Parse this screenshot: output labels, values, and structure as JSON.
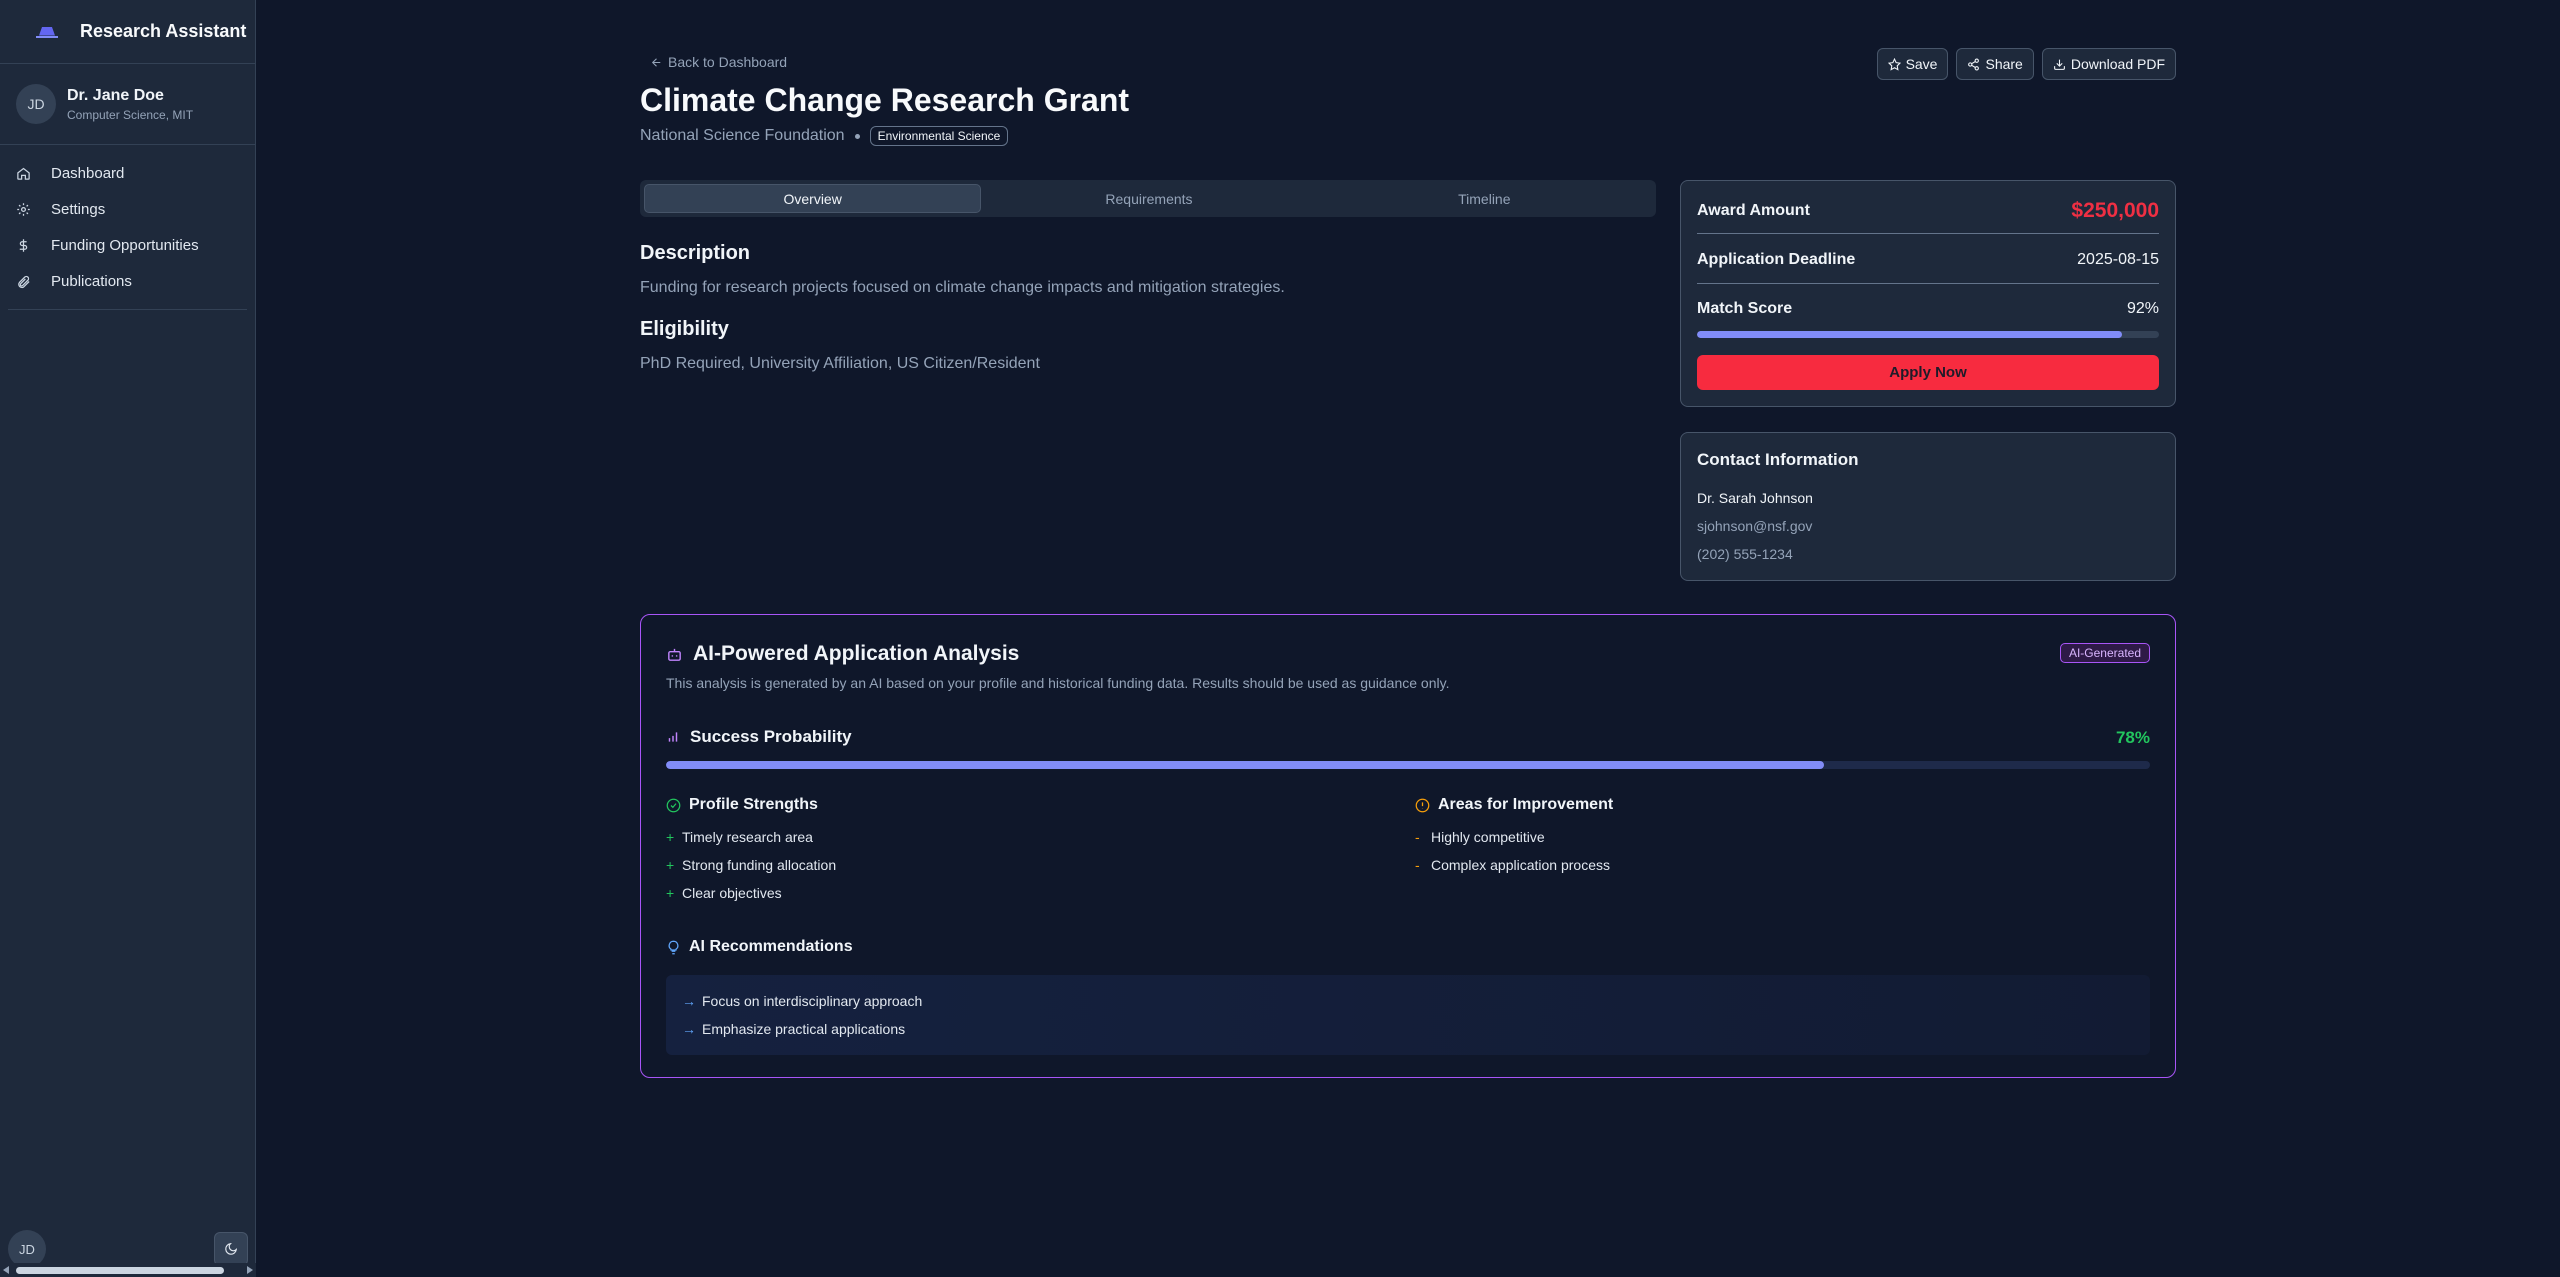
{
  "sidebar": {
    "app_name": "Research Assistant",
    "user": {
      "initials": "JD",
      "name": "Dr. Jane Doe",
      "affiliation": "Computer Science, MIT"
    },
    "nav": [
      {
        "label": "Dashboard",
        "icon": "home-icon"
      },
      {
        "label": "Settings",
        "icon": "gear-icon"
      },
      {
        "label": "Funding Opportunities",
        "icon": "dollar-icon"
      },
      {
        "label": "Publications",
        "icon": "paperclip-icon"
      }
    ],
    "bottom_initials": "JD"
  },
  "header": {
    "back_label": "Back to Dashboard",
    "title": "Climate Change Research Grant",
    "organization": "National Science Foundation",
    "category_tag": "Environmental Science",
    "actions": {
      "save": "Save",
      "share": "Share",
      "download": "Download PDF"
    }
  },
  "tabs": [
    "Overview",
    "Requirements",
    "Timeline"
  ],
  "overview": {
    "description_heading": "Description",
    "description": "Funding for research projects focused on climate change impacts and mitigation strategies.",
    "eligibility_heading": "Eligibility",
    "eligibility": "PhD Required, University Affiliation, US Citizen/Resident"
  },
  "summary_card": {
    "award_label": "Award Amount",
    "award_value": "$250,000",
    "deadline_label": "Application Deadline",
    "deadline_value": "2025-08-15",
    "match_label": "Match Score",
    "match_value": "92%",
    "match_fraction": 0.92,
    "apply_label": "Apply Now"
  },
  "contact": {
    "heading": "Contact Information",
    "name": "Dr. Sarah Johnson",
    "email": "sjohnson@nsf.gov",
    "phone": "(202) 555-1234"
  },
  "ai_analysis": {
    "title": "AI-Powered Application Analysis",
    "badge": "AI-Generated",
    "disclaimer": "This analysis is generated by an AI based on your profile and historical funding data. Results should be used as guidance only.",
    "success_label": "Success Probability",
    "success_value": "78%",
    "success_fraction": 0.78,
    "strengths_heading": "Profile Strengths",
    "strengths": [
      "Timely research area",
      "Strong funding allocation",
      "Clear objectives"
    ],
    "improvements_heading": "Areas for Improvement",
    "improvements": [
      "Highly competitive",
      "Complex application process"
    ],
    "recommendations_heading": "AI Recommendations",
    "recommendations": [
      "Focus on interdisciplinary approach",
      "Emphasize practical applications"
    ]
  },
  "colors": {
    "accent": "#818cf8",
    "award": "#ef2f43",
    "apply": "#f72b3f",
    "success": "#22c55e",
    "ai_border": "#a855f7"
  }
}
